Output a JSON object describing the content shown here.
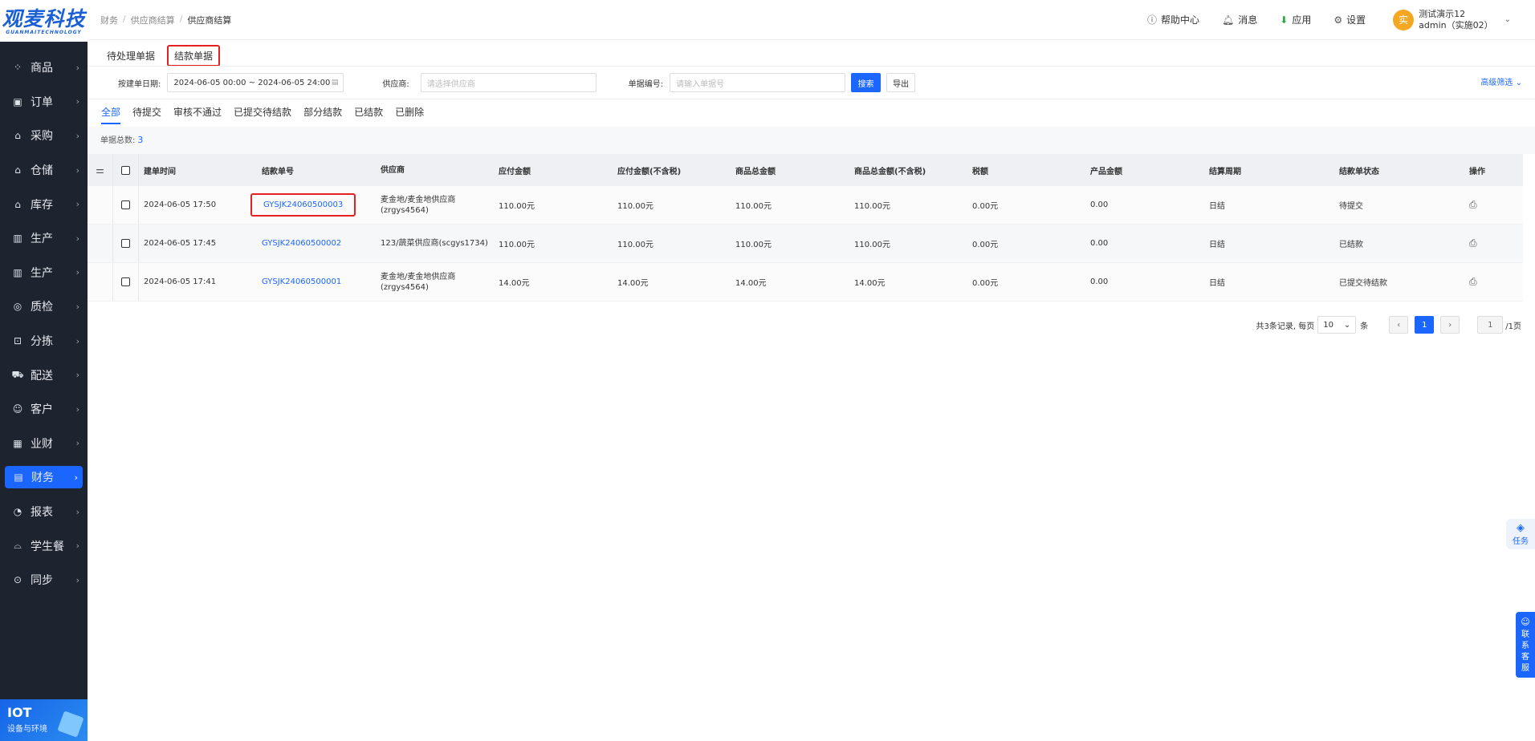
{
  "logo": {
    "main": "观麦科技",
    "sub": "GUANMAITECHNOLOGY"
  },
  "sidebar": {
    "items": [
      {
        "label": "商品",
        "icon": "⁘"
      },
      {
        "label": "订单",
        "icon": "▣"
      },
      {
        "label": "采购",
        "icon": "⌂"
      },
      {
        "label": "仓储",
        "icon": "⌂"
      },
      {
        "label": "库存",
        "icon": "⌂"
      },
      {
        "label": "生产",
        "icon": "▥"
      },
      {
        "label": "生产",
        "icon": "▥"
      },
      {
        "label": "质检",
        "icon": "◎"
      },
      {
        "label": "分拣",
        "icon": "⊡"
      },
      {
        "label": "配送",
        "icon": "⛟"
      },
      {
        "label": "客户",
        "icon": "☺"
      },
      {
        "label": "业财",
        "icon": "▦"
      },
      {
        "label": "财务",
        "icon": "▤"
      },
      {
        "label": "报表",
        "icon": "◔"
      },
      {
        "label": "学生餐",
        "icon": "⌓"
      },
      {
        "label": "同步",
        "icon": "⊙"
      }
    ],
    "chevron": "›"
  },
  "iot": {
    "title": "IOT",
    "sub": "设备与环境"
  },
  "breadcrumb": {
    "l1": "财务",
    "l2": "供应商结算",
    "l3": "供应商结算",
    "sep": "/"
  },
  "header": {
    "help": "帮助中心",
    "message": "消息",
    "apps": "应用",
    "settings": "设置",
    "avatar_char": "实",
    "user_name": "测试演示12",
    "user_role": "admin（实施02）"
  },
  "page_tabs": {
    "pending": "待处理单据",
    "settlement": "结款单据"
  },
  "filters": {
    "date_label": "按建单日期:",
    "date_value": "2024-06-05 00:00 ~ 2024-06-05 24:00",
    "supplier_label": "供应商:",
    "supplier_placeholder": "请选择供应商",
    "number_label": "单据编号:",
    "number_placeholder": "请输入单据号",
    "search": "搜索",
    "export": "导出",
    "advanced": "高级筛选"
  },
  "status_tabs": [
    "全部",
    "待提交",
    "审核不通过",
    "已提交待结款",
    "部分结款",
    "已结款",
    "已删除"
  ],
  "total": {
    "label": "单据总数:",
    "count": "3"
  },
  "table": {
    "columns": [
      "建单时间",
      "结款单号",
      "供应商",
      "应付金额",
      "应付金额(不含税)",
      "商品总金额",
      "商品总金额(不含税)",
      "税额",
      "产品金额",
      "结算周期",
      "结款单状态",
      "操作"
    ],
    "rows": [
      {
        "time": "2024-06-05 17:50",
        "no": "GYSJK24060500003",
        "supplier": "麦金地/麦金地供应商(zrgys4564)",
        "payable": "110.00元",
        "payable_ex": "110.00元",
        "goods": "110.00元",
        "goods_ex": "110.00元",
        "tax": "0.00元",
        "product": "0.00",
        "cycle": "日结",
        "status": "待提交"
      },
      {
        "time": "2024-06-05 17:45",
        "no": "GYSJK24060500002",
        "supplier": "123/蔬菜供应商(scgys1734)",
        "payable": "110.00元",
        "payable_ex": "110.00元",
        "goods": "110.00元",
        "goods_ex": "110.00元",
        "tax": "0.00元",
        "product": "0.00",
        "cycle": "日结",
        "status": "已结款"
      },
      {
        "time": "2024-06-05 17:41",
        "no": "GYSJK24060500001",
        "supplier": "麦金地/麦金地供应商(zrgys4564)",
        "payable": "14.00元",
        "payable_ex": "14.00元",
        "goods": "14.00元",
        "goods_ex": "14.00元",
        "tax": "0.00元",
        "product": "0.00",
        "cycle": "日结",
        "status": "已提交待结款"
      }
    ]
  },
  "pager": {
    "summary": "共3条记录, 每页",
    "size": "10",
    "unit": "条",
    "prev": "‹",
    "current": "1",
    "next": "›",
    "jump": "1",
    "pages": "/1页"
  },
  "float": {
    "task": "任务",
    "cs": [
      "联",
      "系",
      "客",
      "服"
    ]
  },
  "colors": {
    "accent": "#1a66ff",
    "highlight": "#e52020",
    "sidebar": "#1e2330"
  }
}
